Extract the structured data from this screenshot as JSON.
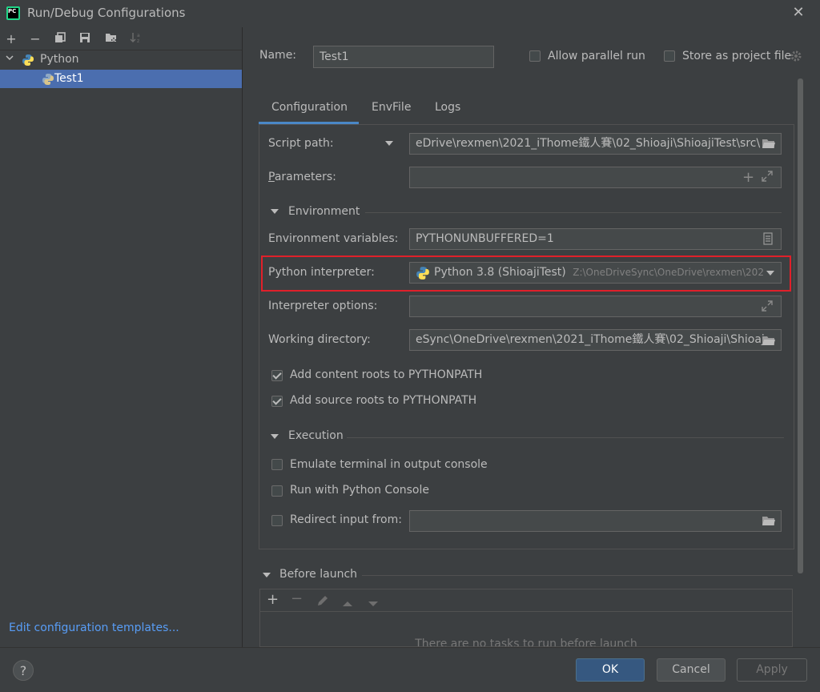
{
  "window": {
    "title": "Run/Debug Configurations"
  },
  "left_toolbar": {
    "icons": [
      "add-icon",
      "remove-icon",
      "copy-icon",
      "save-icon",
      "new-folder-icon",
      "sort-icon"
    ]
  },
  "tree": {
    "group_label": "Python",
    "items": [
      {
        "label": "Test1"
      }
    ]
  },
  "edit_templates_link": "Edit configuration templates...",
  "header": {
    "name_label": "Name:",
    "name_value": "Test1",
    "allow_parallel_label": "Allow parallel run",
    "store_project_label": "Store as project file"
  },
  "tabs": [
    {
      "label": "Configuration",
      "active": true
    },
    {
      "label": "EnvFile",
      "active": false
    },
    {
      "label": "Logs",
      "active": false
    }
  ],
  "form": {
    "script_path_label": "Script path:",
    "script_path_value": "eDrive\\rexmen\\2021_iThome鐵人賽\\02_Shioaji\\ShioajiTest\\src\\",
    "parameters_label": "Parameters:",
    "parameters_value": "",
    "environment_section": "Environment",
    "env_vars_label": "Environment variables:",
    "env_vars_value": "PYTHONUNBUFFERED=1",
    "interpreter_label": "Python interpreter:",
    "interpreter_value": "Python 3.8 (ShioajiTest)",
    "interpreter_path": "Z:\\OneDriveSync\\OneDrive\\rexmen\\202",
    "interpreter_options_label": "Interpreter options:",
    "interpreter_options_value": "",
    "working_dir_label": "Working directory:",
    "working_dir_value": "eSync\\OneDrive\\rexmen\\2021_iThome鐵人賽\\02_Shioaji\\Shioaj",
    "add_content_roots_label": "Add content roots to PYTHONPATH",
    "add_source_roots_label": "Add source roots to PYTHONPATH",
    "execution_section": "Execution",
    "emulate_terminal_label": "Emulate terminal in output console",
    "run_console_label": "Run with Python Console",
    "redirect_input_label": "Redirect input from:",
    "redirect_input_value": ""
  },
  "before_launch": {
    "section_label": "Before launch",
    "empty_text": "There are no tasks to run before launch"
  },
  "buttons": {
    "ok": "OK",
    "cancel": "Cancel",
    "apply": "Apply",
    "help": "?"
  },
  "colors": {
    "accent": "#4a88c7",
    "selection": "#4b6eaf",
    "highlight_box": "#e0202a",
    "link": "#589df6"
  }
}
